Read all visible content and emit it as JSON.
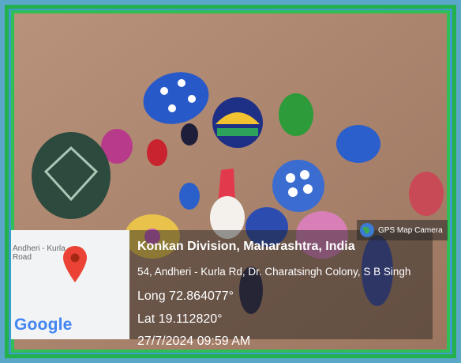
{
  "map": {
    "road_label": "Andheri - Kurla Road",
    "brand": "Google"
  },
  "badge": {
    "label": "GPS Map Camera"
  },
  "location": {
    "title": "Konkan Division, Maharashtra, India",
    "address": "54, Andheri - Kurla Rd, Dr. Charatsingh Colony, S B Singh",
    "longitude": "Long 72.864077°",
    "latitude": "Lat 19.112820°",
    "datetime": "27/7/2024 09:59 AM"
  },
  "colors": {
    "frame": "#22b14c",
    "map_pin": "#ea4335",
    "google_blue": "#4285f4"
  }
}
